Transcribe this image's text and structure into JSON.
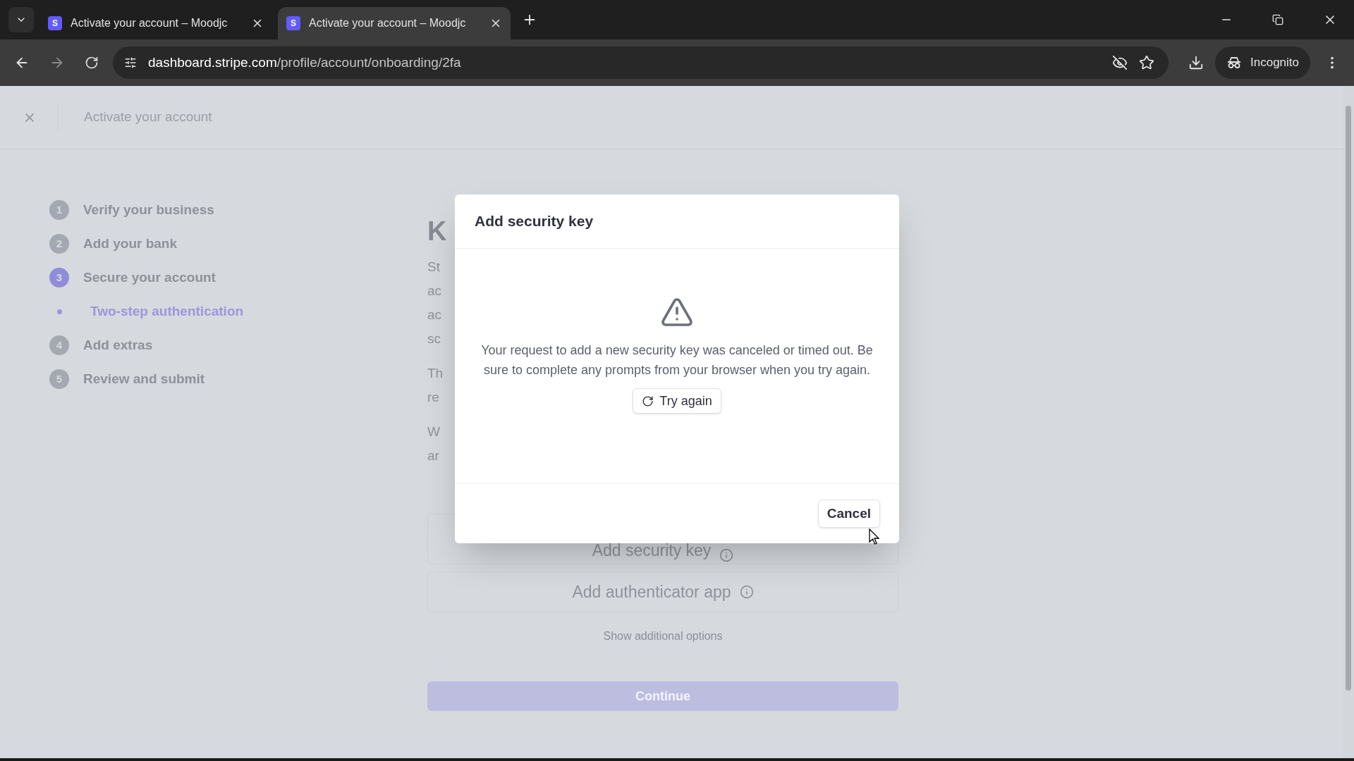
{
  "browser": {
    "tabs": [
      {
        "favicon_letter": "S",
        "title": "Activate your account – Moodjc",
        "selected": false
      },
      {
        "favicon_letter": "S",
        "title": "Activate your account – Moodjc",
        "selected": true
      }
    ],
    "url_host": "dashboard.stripe.com",
    "url_path": "/profile/account/onboarding/2fa",
    "profile": "Incognito"
  },
  "header": {
    "title": "Activate your account"
  },
  "steps": [
    {
      "number": "1",
      "label": "Verify your business",
      "selected": false
    },
    {
      "number": "2",
      "label": "Add your bank",
      "selected": false
    },
    {
      "number": "3",
      "label": "Secure your account",
      "selected": true,
      "children": [
        {
          "label": "Two-step authentication",
          "selected": true
        }
      ]
    },
    {
      "number": "4",
      "label": "Add extras",
      "selected": false
    },
    {
      "number": "5",
      "label": "Review and submit",
      "selected": false
    }
  ],
  "main": {
    "heading": "K",
    "paragraphs": [
      [
        "St",
        "ac",
        "ac",
        "sc"
      ],
      [
        "Th",
        "re"
      ],
      [
        "W",
        "ar"
      ]
    ],
    "options": [
      {
        "label": "Add security key"
      },
      {
        "label": "Add authenticator app"
      }
    ],
    "more_link": "Show additional options",
    "continue": {
      "label": "Continue",
      "disabled": true
    }
  },
  "dialog": {
    "title": "Add security key",
    "message": "Your request to add a new security key was canceled or timed out. Be sure to complete any prompts from your browser when you try again.",
    "retry": "Try again",
    "cancel": "Cancel"
  }
}
